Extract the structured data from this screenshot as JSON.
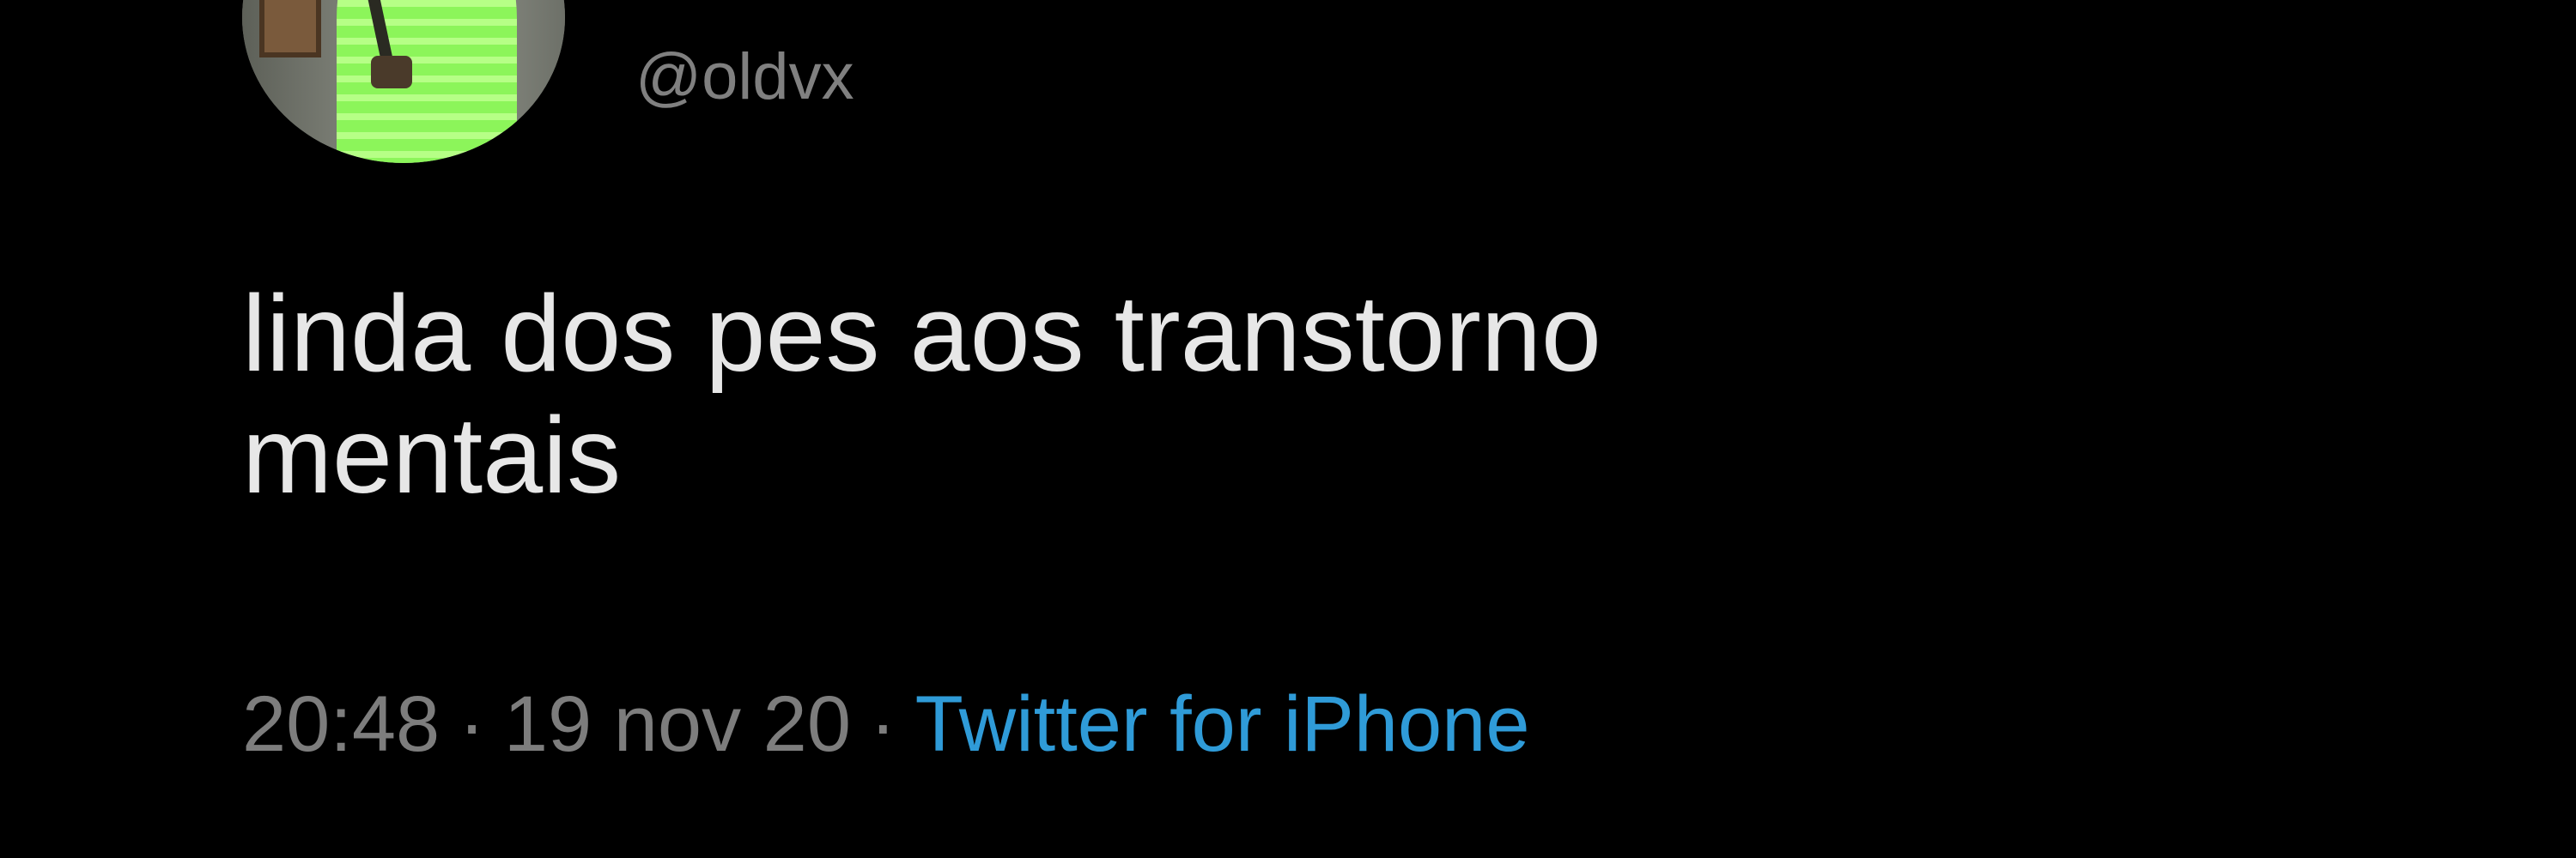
{
  "tweet": {
    "handle": "@oldvx",
    "text": "linda dos pes aos transtorno\nmentais",
    "time": "20:48",
    "separator": "·",
    "date": "19 nov 20",
    "source": "Twitter for iPhone"
  },
  "colors": {
    "background": "#000000",
    "text": "#e7e7e7",
    "secondary_text": "#7d7d7d",
    "link": "#2f9bd8"
  }
}
